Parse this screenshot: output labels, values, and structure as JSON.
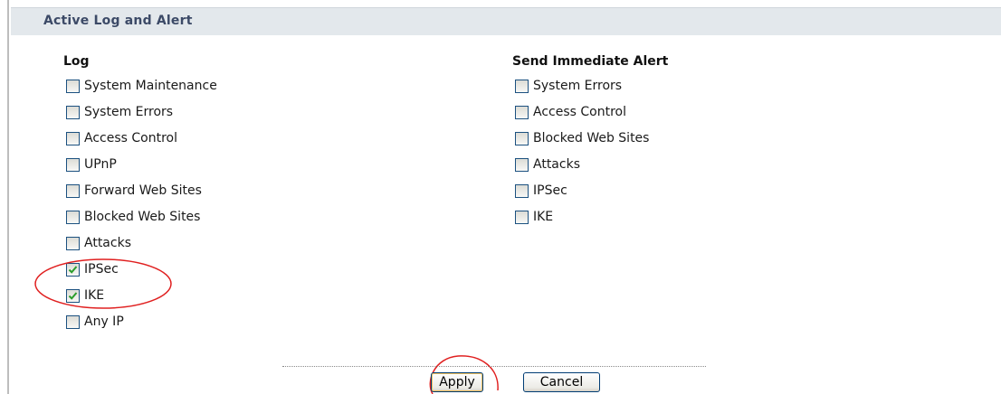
{
  "section": {
    "title": "Active Log and Alert"
  },
  "log": {
    "heading": "Log",
    "items": [
      {
        "label": "System Maintenance",
        "checked": false
      },
      {
        "label": "System Errors",
        "checked": false
      },
      {
        "label": "Access Control",
        "checked": false
      },
      {
        "label": "UPnP",
        "checked": false
      },
      {
        "label": "Forward Web Sites",
        "checked": false
      },
      {
        "label": "Blocked Web Sites",
        "checked": false
      },
      {
        "label": "Attacks",
        "checked": false
      },
      {
        "label": "IPSec",
        "checked": true
      },
      {
        "label": "IKE",
        "checked": true
      },
      {
        "label": "Any IP",
        "checked": false
      }
    ]
  },
  "alert": {
    "heading": "Send Immediate Alert",
    "items": [
      {
        "label": "System Errors",
        "checked": false
      },
      {
        "label": "Access Control",
        "checked": false
      },
      {
        "label": "Blocked Web Sites",
        "checked": false
      },
      {
        "label": "Attacks",
        "checked": false
      },
      {
        "label": "IPSec",
        "checked": false
      },
      {
        "label": "IKE",
        "checked": false
      }
    ]
  },
  "buttons": {
    "apply": "Apply",
    "cancel": "Cancel"
  },
  "colors": {
    "header_bg": "#e3e8ec",
    "header_text": "#3c4a67",
    "checkmark": "#2a9d2a",
    "annotation": "#e02020"
  }
}
